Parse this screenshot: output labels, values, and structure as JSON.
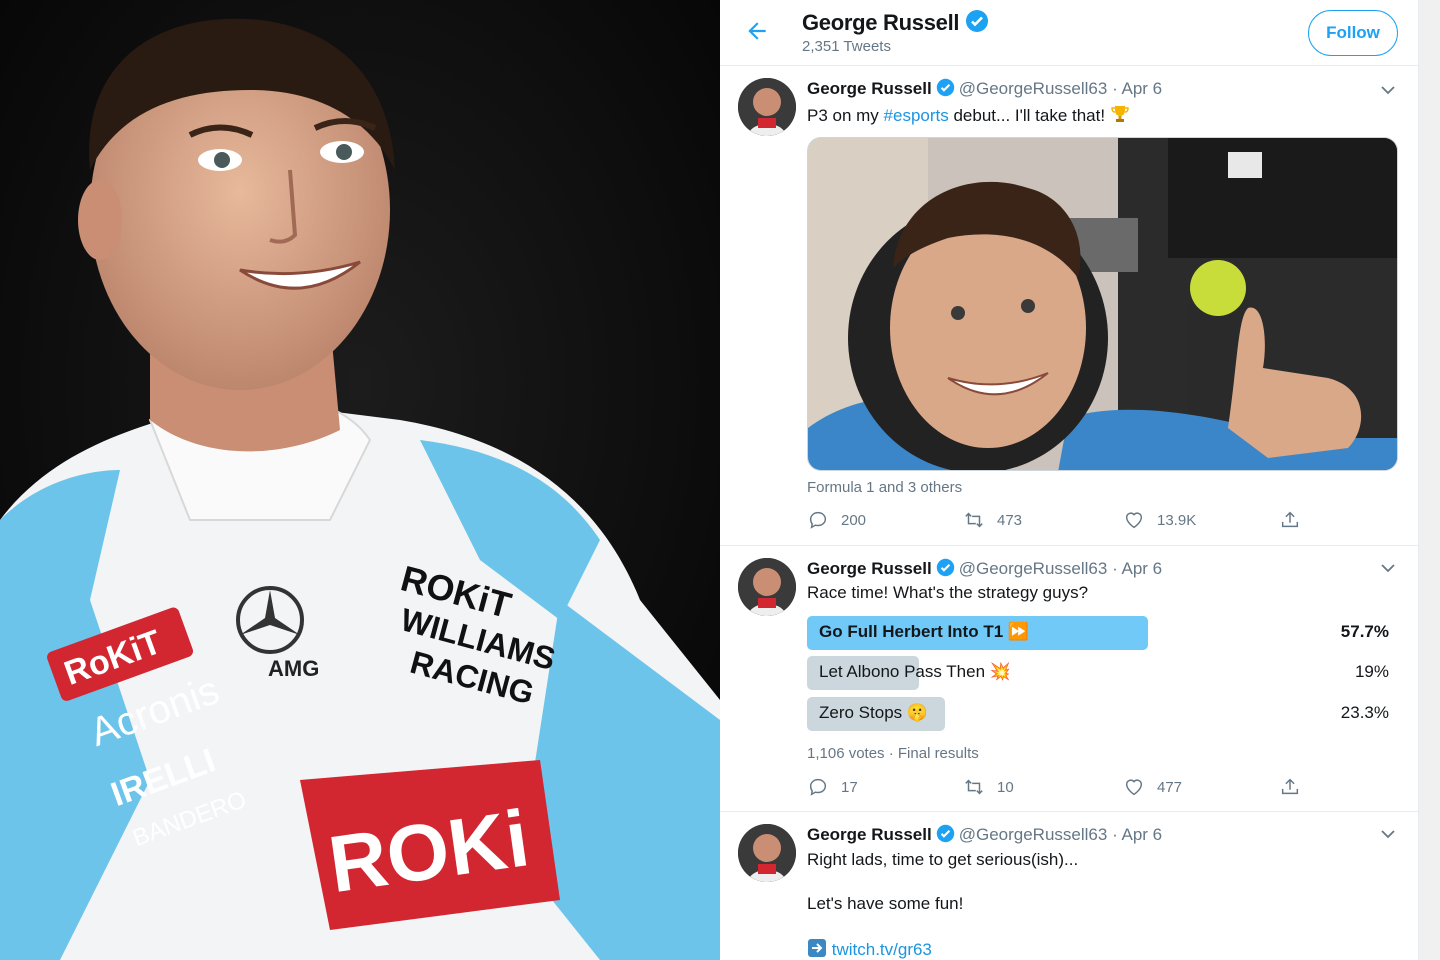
{
  "header": {
    "name": "George Russell",
    "tweet_count": "2,351 Tweets",
    "follow_label": "Follow"
  },
  "tweets": [
    {
      "name": "George Russell",
      "handle": "@GeorgeRussell63",
      "date": "· Apr 6",
      "text_before": "P3 on my ",
      "hashtag": "#esports",
      "text_after": " debut... I'll take that! ",
      "tagged": "Formula 1 and 3 others",
      "replies": "200",
      "retweets": "473",
      "likes": "13.9K"
    },
    {
      "name": "George Russell",
      "handle": "@GeorgeRussell63",
      "date": "· Apr 6",
      "text": "Race time! What's the strategy guys?",
      "poll": [
        {
          "label": "Go Full Herbert Into T1 ⏩",
          "pct": "57.7%",
          "value": 57.7,
          "winner": true
        },
        {
          "label": "Let Albono Pass Then 💥",
          "pct": "19%",
          "value": 19,
          "winner": false
        },
        {
          "label": "Zero Stops 🤫",
          "pct": "23.3%",
          "value": 23.3,
          "winner": false
        }
      ],
      "poll_meta": "1,106 votes · Final results",
      "replies": "17",
      "retweets": "10",
      "likes": "477"
    },
    {
      "name": "George Russell",
      "handle": "@GeorgeRussell63",
      "date": "· Apr 6",
      "line1": "Right lads, time to get serious(ish)...",
      "line2": "Let's have some fun!",
      "link": "twitch.tv/gr63"
    }
  ],
  "colors": {
    "accent": "#1da1f2",
    "poll_winner": "#71c9f8",
    "poll_other": "#ccd6dd"
  },
  "icons": [
    "back-arrow-icon",
    "verified-badge-icon",
    "chevron-down-icon",
    "reply-icon",
    "retweet-icon",
    "like-icon",
    "share-icon",
    "trophy-icon",
    "arrow-right-emoji-icon"
  ]
}
